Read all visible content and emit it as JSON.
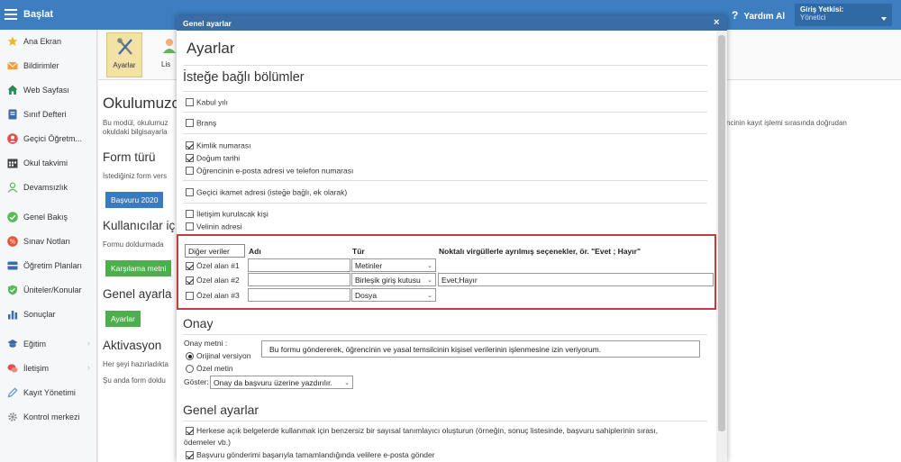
{
  "topbar": {
    "brand": "Başlat",
    "help": "Yardım Al",
    "role_label": "Giriş Yetkisi:",
    "role_value": "Yönetici",
    "color": "#3c7ebf"
  },
  "sidebar": {
    "items": [
      {
        "label": "Ana Ekran",
        "icon": "star-icon",
        "color": "#f0b429"
      },
      {
        "label": "Bildirimler",
        "icon": "envelope-icon",
        "color": "#f0a040"
      },
      {
        "label": "Web Sayfası",
        "icon": "home-icon",
        "color": "#2e8b57"
      },
      {
        "label": "Sınıf Defteri",
        "icon": "notebook-icon",
        "color": "#3a6da6"
      },
      {
        "label": "Geçici Öğretm...",
        "icon": "person-icon",
        "color": "#d9534f"
      },
      {
        "label": "Okul takvimi",
        "icon": "calendar-icon",
        "color": "#444444"
      },
      {
        "label": "Devamsızlık",
        "icon": "user-outline-icon",
        "color": "#5cb85c"
      },
      {
        "label": "Genel Bakış",
        "icon": "check-circle-icon",
        "color": "#5cb85c"
      },
      {
        "label": "Sınav Notları",
        "icon": "grade-icon",
        "color": "#e05a3a"
      },
      {
        "label": "Öğretim Planları",
        "icon": "plan-icon",
        "color": "#3a6da6"
      },
      {
        "label": "Üniteler/Konular",
        "icon": "shield-icon",
        "color": "#5cb85c"
      },
      {
        "label": "Sonuçlar",
        "icon": "bar-chart-icon",
        "color": "#3a6da6"
      },
      {
        "label": "Eğitim",
        "icon": "graduation-icon",
        "color": "#3a6da6"
      },
      {
        "label": "İletişim",
        "icon": "chat-icon",
        "color": "#d9534f"
      },
      {
        "label": "Kayıt Yönetimi",
        "icon": "pen-icon",
        "color": "#5b8fd0"
      },
      {
        "label": "Kontrol merkezi",
        "icon": "gear-icon",
        "color": "#888888"
      }
    ]
  },
  "ribbon": {
    "settings_label": "Ayarlar",
    "list_label": "Lis"
  },
  "background_page": {
    "heading": "Okulumuzc",
    "intro_line1": "Bu modül, okulumuz",
    "intro_line2": "okuldaki bilgisayarla",
    "intro_right": "öğrencinin kayıt işlemi sırasında doğrudan",
    "form_type_heading": "Form türü",
    "form_type_text": "İstediğiniz form vers",
    "application_button": "Başvuru 2020",
    "users_heading": "Kullanıcılar iç",
    "users_text": "Formu doldurmada",
    "welcome_button": "Karşılama metni",
    "general_heading": "Genel ayarla",
    "settings_button": "Ayarlar",
    "activation_heading": "Aktivasyon",
    "activation_text1": "Her şeyi hazırladıkta",
    "activation_text2": "Şu anda form doldu"
  },
  "modal": {
    "title": "Genel ayarlar",
    "close": "×",
    "page_title": "Ayarlar",
    "optional_heading": "İsteğe bağlı bölümler",
    "optional_fields": [
      {
        "label": "Kabul yılı",
        "checked": false
      },
      {
        "label": "Branş",
        "checked": false
      },
      {
        "label": "Kimlik numarası",
        "checked": true
      },
      {
        "label": "Doğum tarihi",
        "checked": true
      },
      {
        "label": "Öğrencinin e-posta adresi ve telefon numarası",
        "checked": false
      },
      {
        "label": "Geçici ikamet adresi (isteğe bağlı, ek olarak)",
        "checked": false
      },
      {
        "label": "İletişim kurulacak kişi",
        "checked": false
      },
      {
        "label": "Velinin adresi",
        "checked": false
      }
    ],
    "custom_fields": {
      "header_other": "Diğer veriler",
      "header_name": "Adı",
      "header_type": "Tür",
      "header_options": "Noktalı virgüllerle ayrılmış seçenekler, ör. \"Evet ; Hayır\"",
      "rows": [
        {
          "label": "Özel alan #1",
          "checked": true,
          "name": "",
          "type": "Metinler",
          "options": ""
        },
        {
          "label": "Özel alan #2",
          "checked": true,
          "name": "",
          "type": "Birleşik giriş kutusu",
          "options": "Evet;Hayır"
        },
        {
          "label": "Özel alan #3",
          "checked": false,
          "name": "",
          "type": "Dosya",
          "options": ""
        }
      ]
    },
    "consent": {
      "heading": "Onay",
      "text_label": "Onay metni :",
      "radio_original": "Orijinal versiyon",
      "radio_custom": "Özel metin",
      "original_selected": true,
      "consent_text": "Bu formu göndererek, öğrencinin ve yasal temsilcinin kişisel verilerinin işlenmesine izin veriyorum.",
      "show_label": "Göster:",
      "show_value": "Onay da başvuru üzerine yazdırılır."
    },
    "general": {
      "heading": "Genel ayarlar",
      "option1_line1": "Herkese açık belgelerde kullanmak için benzersiz bir sayısal tanımlayıcı oluşturun (örneğin, sonuç listesinde, başvuru sahiplerinin sırası,",
      "option1_line2": "ödemeler vb.)",
      "option1_checked": true,
      "option2": "Başvuru gönderimi başarıyla tamamlandığında velilere e-posta gönder",
      "option2_checked": true
    },
    "highlight_color": "#c43c3c"
  }
}
